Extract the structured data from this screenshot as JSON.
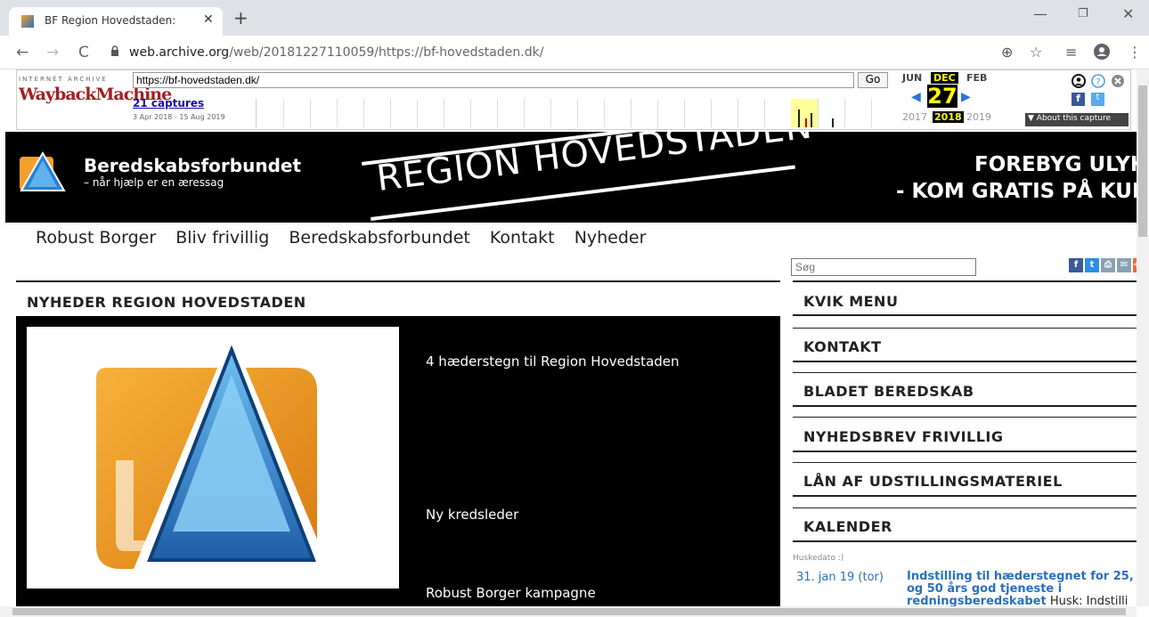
{
  "browser": {
    "tab_title": "BF Region Hovedstaden: BF Regi",
    "tab_close": "✕",
    "new_tab": "+",
    "url_host": "web.archive.org",
    "url_path": "/web/20181227110059/https://bf-hovedstaden.dk/",
    "back": "←",
    "forward": "→",
    "reload": "C",
    "lock": "🔒",
    "zoom_icon": "⊕",
    "star_icon": "☆",
    "menu_icon": "⋮",
    "min": "—",
    "max": "❐",
    "close": "✕"
  },
  "wayback": {
    "logo_top": "INTERNET ARCHIVE",
    "logo": "WaybackMachine",
    "url_value": "https://bf-hovedstaden.dk/",
    "go": "Go",
    "captures": "21 captures",
    "range": "3 Apr 2018 - 15 Aug 2019",
    "month_prev": "JUN",
    "month_cur": "DEC",
    "month_next": "FEB",
    "day": "27",
    "year_prev": "2017",
    "year_cur": "2018",
    "year_next": "2019",
    "about": "▼ About this capture",
    "fb": "f",
    "tw": "t"
  },
  "banner": {
    "org_name": "Beredskabsforbundet",
    "org_sub": "– når hjælp er en æressag",
    "region": "REGION HOVEDSTADEN",
    "promo_line1": "FOREBYG ULYKK",
    "promo_line2": "- KOM GRATIS PÅ KURS"
  },
  "nav": {
    "items": [
      "Robust Borger",
      "Bliv frivillig",
      "Beredskabsforbundet",
      "Kontakt",
      "Nyheder"
    ]
  },
  "search": {
    "placeholder": "Søg"
  },
  "news": {
    "title": "NYHEDER REGION HOVEDSTADEN",
    "items": [
      "4 hæderstegn til Region Hovedstaden",
      "Ny kredsleder",
      "Robust Borger kampagne"
    ]
  },
  "sidebar": {
    "items": [
      "KVIK MENU",
      "KONTAKT",
      "BLADET BEREDSKAB",
      "NYHEDSBREV FRIVILLIG",
      "LÅN AF UDSTILLINGSMATERIEL",
      "KALENDER"
    ],
    "calendar_label": "Huskedato :)",
    "calendar_date": "31. jan 19 (tor)",
    "calendar_title": "Indstilling til hæderstegnet for 25, og 50 års god tjeneste i redningsberedskabet",
    "calendar_excerpt": " Husk: Indstilli"
  },
  "colors": {
    "wayback_highlight": "#ffff00",
    "link_blue": "#2a6fc0",
    "banner_bg": "#000000"
  }
}
